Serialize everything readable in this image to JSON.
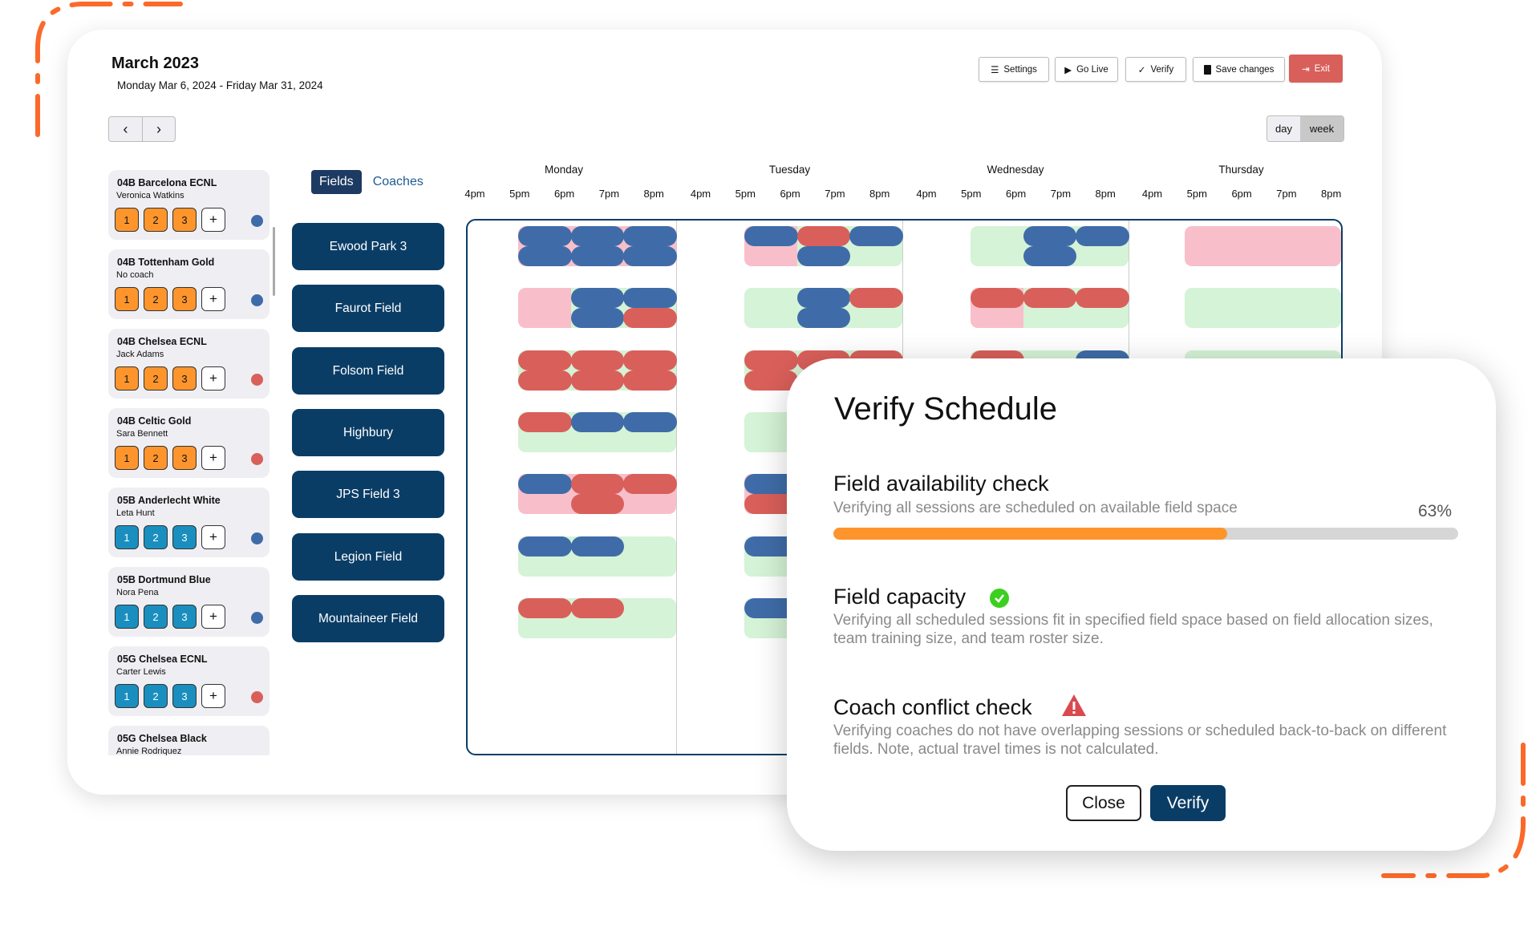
{
  "header": {
    "title": "March 2023",
    "date_range": "Monday Mar 6, 2024 - Friday Mar 31, 2024"
  },
  "nav": {
    "prev_icon": "chevron-left-icon",
    "next_icon": "chevron-right-icon",
    "prev": "‹",
    "next": "›"
  },
  "toolbar": {
    "settings": "Settings",
    "go_live": "Go Live",
    "verify": "Verify",
    "save": "Save changes",
    "exit": "Exit"
  },
  "view_toggle": {
    "day": "day",
    "week": "week",
    "selected": "week"
  },
  "tabs": {
    "fields": "Fields",
    "coaches": "Coaches",
    "selected": "Fields"
  },
  "colors": {
    "navy": "#0a3d66",
    "blue": "#3f6ca8",
    "red": "#d95f5a",
    "pink": "#f8bfca",
    "green": "#d5f3d6",
    "orange": "#fd952c",
    "teal": "#1a8fbf",
    "exit": "#d95f5a"
  },
  "teams": [
    {
      "name": "04B Barcelona ECNL",
      "coach": "Veronica Watkins",
      "badges": [
        "1",
        "2",
        "3"
      ],
      "badge_color": "orange",
      "dot": "blue"
    },
    {
      "name": "04B Tottenham Gold",
      "coach": "No coach",
      "badges": [
        "1",
        "2",
        "3"
      ],
      "badge_color": "orange",
      "dot": "blue"
    },
    {
      "name": "04B Chelsea ECNL",
      "coach": "Jack Adams",
      "badges": [
        "1",
        "2",
        "3"
      ],
      "badge_color": "orange",
      "dot": "red"
    },
    {
      "name": "04B Celtic Gold",
      "coach": "Sara Bennett",
      "badges": [
        "1",
        "2",
        "3"
      ],
      "badge_color": "orange",
      "dot": "red"
    },
    {
      "name": "05B Anderlecht White",
      "coach": "Leta Hunt",
      "badges": [
        "1",
        "2",
        "3"
      ],
      "badge_color": "teal",
      "dot": "blue"
    },
    {
      "name": "05B Dortmund Blue",
      "coach": "Nora Pena",
      "badges": [
        "1",
        "2",
        "3"
      ],
      "badge_color": "teal",
      "dot": "blue"
    },
    {
      "name": "05G Chelsea ECNL",
      "coach": "Carter Lewis",
      "badges": [
        "1",
        "2",
        "3"
      ],
      "badge_color": "teal",
      "dot": "red"
    },
    {
      "name": "05G Chelsea Black",
      "coach": "Annie Rodriquez",
      "badges": [],
      "badge_color": "teal",
      "dot": null
    }
  ],
  "add_badge": "+",
  "days": [
    {
      "name": "Monday",
      "hours": [
        "4pm",
        "5pm",
        "6pm",
        "7pm",
        "8pm"
      ]
    },
    {
      "name": "Tuesday",
      "hours": [
        "4pm",
        "5pm",
        "6pm",
        "7pm",
        "8pm"
      ]
    },
    {
      "name": "Wednesday",
      "hours": [
        "4pm",
        "5pm",
        "6pm",
        "7pm",
        "8pm"
      ]
    },
    {
      "name": "Thursday",
      "hours": [
        "4pm",
        "5pm",
        "6pm",
        "7pm",
        "8pm"
      ]
    }
  ],
  "rows": [
    {
      "field": "Ewood Park 3",
      "cells": [
        {
          "bg": [
            "pink",
            "pink",
            "pink"
          ],
          "top": [
            "blue",
            "blue",
            "blue"
          ],
          "bottom": [
            "blue",
            "blue",
            "blue"
          ]
        },
        {
          "bg": [
            "pink",
            "green",
            "green"
          ],
          "top": [
            "blue",
            "red",
            "blue"
          ],
          "bottom": [
            null,
            "blue",
            null
          ]
        },
        {
          "bg": [
            "green",
            "green",
            "green"
          ],
          "top": [
            null,
            "blue",
            "blue"
          ],
          "bottom": [
            null,
            "blue",
            null
          ]
        },
        {
          "bg": [
            "pink",
            "pink",
            "pink"
          ],
          "top": [
            null,
            null,
            null
          ],
          "bottom": [
            null,
            null,
            null
          ]
        }
      ]
    },
    {
      "field": "Faurot Field",
      "cells": [
        {
          "bg": [
            "pink",
            "green",
            "green"
          ],
          "top": [
            null,
            "blue",
            "blue"
          ],
          "bottom": [
            null,
            "blue",
            "red"
          ]
        },
        {
          "bg": [
            "green",
            "green",
            "green"
          ],
          "top": [
            null,
            "blue",
            "red"
          ],
          "bottom": [
            null,
            "blue",
            null
          ]
        },
        {
          "bg": [
            "pink",
            "green",
            "green"
          ],
          "top": [
            "red",
            "red",
            "red"
          ],
          "bottom": [
            null,
            null,
            null
          ]
        },
        {
          "bg": [
            "green",
            "green",
            "green"
          ],
          "top": [
            null,
            null,
            null
          ],
          "bottom": [
            null,
            null,
            null
          ]
        }
      ]
    },
    {
      "field": "Folsom Field",
      "cells": [
        {
          "bg": [
            "green",
            "green",
            "green"
          ],
          "top": [
            "red",
            "red",
            "red"
          ],
          "bottom": [
            "red",
            "red",
            "red"
          ]
        },
        {
          "bg": [
            "green",
            "green",
            "green"
          ],
          "top": [
            "red",
            "red",
            "red"
          ],
          "bottom": [
            "red",
            null,
            null
          ]
        },
        {
          "bg": [
            "green",
            "green",
            "green"
          ],
          "top": [
            "red",
            null,
            "blue"
          ],
          "bottom": [
            null,
            null,
            null
          ]
        },
        {
          "bg": [
            "green",
            "green",
            "green"
          ],
          "top": [
            null,
            null,
            null
          ],
          "bottom": [
            null,
            null,
            null
          ]
        }
      ]
    },
    {
      "field": "Highbury",
      "cells": [
        {
          "bg": [
            "green",
            "green",
            "green"
          ],
          "top": [
            "red",
            "blue",
            "blue"
          ],
          "bottom": [
            null,
            null,
            null
          ]
        },
        {
          "bg": [
            "green",
            "green",
            "green"
          ],
          "top": [
            null,
            null,
            null
          ],
          "bottom": [
            null,
            null,
            null
          ]
        },
        null,
        null
      ]
    },
    {
      "field": "JPS Field 3",
      "cells": [
        {
          "bg": [
            "pink",
            "pink",
            "pink"
          ],
          "top": [
            "blue",
            "red",
            "red"
          ],
          "bottom": [
            null,
            "red",
            null
          ]
        },
        {
          "bg": [
            "pink",
            "pink",
            "pink"
          ],
          "top": [
            "blue",
            null,
            null
          ],
          "bottom": [
            "red",
            null,
            null
          ]
        },
        null,
        null
      ]
    },
    {
      "field": "Legion Field",
      "cells": [
        {
          "bg": [
            "green",
            "green",
            "green"
          ],
          "top": [
            "blue",
            "blue",
            null
          ],
          "bottom": [
            null,
            null,
            null
          ]
        },
        {
          "bg": [
            "green",
            "green",
            "green"
          ],
          "top": [
            "blue",
            null,
            null
          ],
          "bottom": [
            null,
            null,
            null
          ]
        },
        null,
        null
      ]
    },
    {
      "field": "Mountaineer Field",
      "cells": [
        {
          "bg": [
            "green",
            "green",
            "green"
          ],
          "top": [
            "red",
            "red",
            null
          ],
          "bottom": [
            null,
            null,
            null
          ]
        },
        {
          "bg": [
            "green",
            "green",
            "green"
          ],
          "top": [
            "blue",
            null,
            null
          ],
          "bottom": [
            null,
            null,
            null
          ]
        },
        null,
        null
      ]
    }
  ],
  "modal": {
    "title": "Verify Schedule",
    "checks": [
      {
        "title": "Field availability check",
        "desc": "Verifying all sessions are scheduled on available field space",
        "progress_percent": 63,
        "progress_label": "63%",
        "status": "in-progress"
      },
      {
        "title": "Field capacity",
        "desc": "Verifying all scheduled sessions fit in specified field space based on field allocation sizes, team training size, and team roster size.",
        "status": "passed",
        "icon": "check-circle-icon"
      },
      {
        "title": "Coach conflict check",
        "desc": "Verifying coaches do not have overlapping sessions or scheduled back-to-back on different fields. Note, actual travel times is not calculated.",
        "status": "warning",
        "icon": "warning-triangle-icon"
      }
    ],
    "close": "Close",
    "verify": "Verify"
  }
}
